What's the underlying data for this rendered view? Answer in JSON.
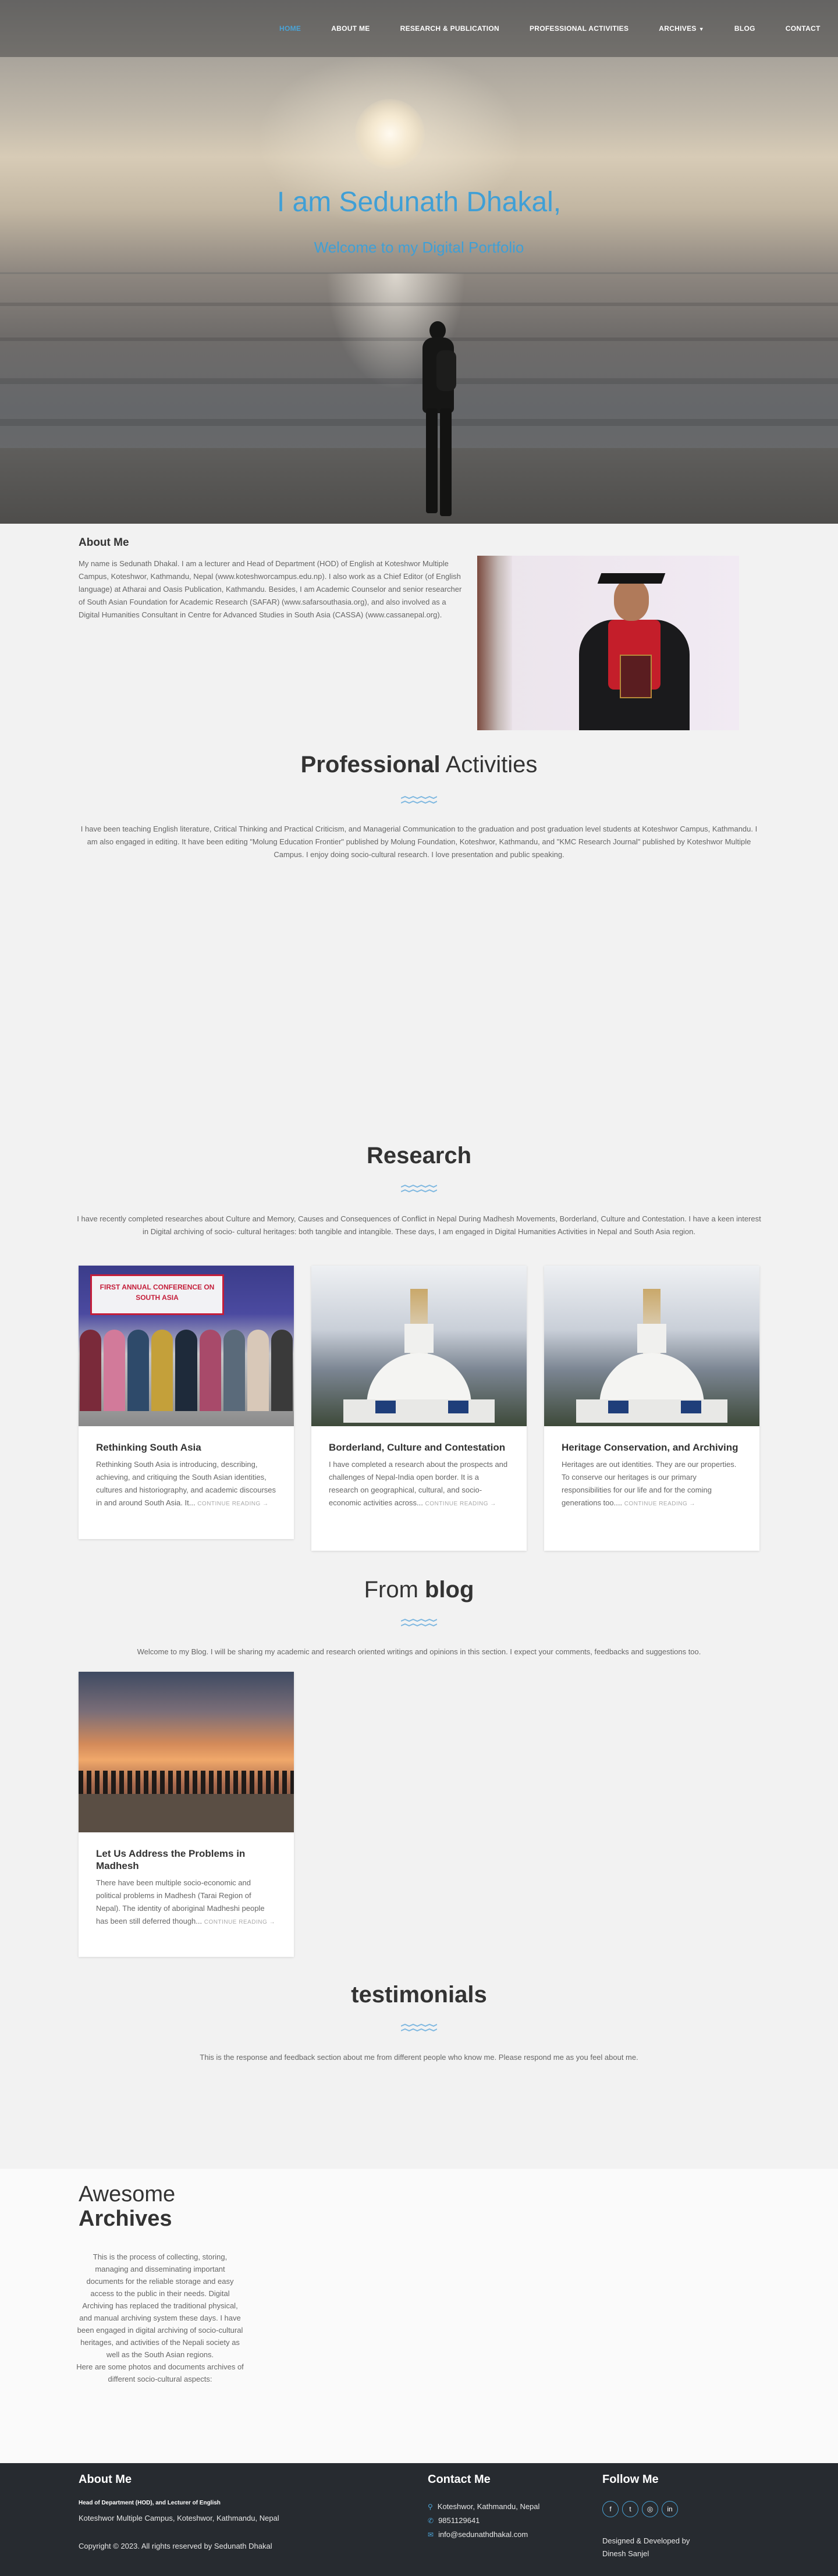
{
  "nav": {
    "items": [
      "HOME",
      "ABOUT ME",
      "RESEARCH & PUBLICATION",
      "PROFESSIONAL ACTIVITIES",
      "ARCHIVES",
      "BLOG",
      "CONTACT"
    ]
  },
  "hero": {
    "title": "I am Sedunath Dhakal,",
    "subtitle": "Welcome to my Digital Portfolio"
  },
  "about": {
    "heading": "About Me",
    "text": "My name is Sedunath Dhakal. I am a lecturer and Head of Department (HOD) of English at Koteshwor Multiple Campus, Koteshwor, Kathmandu, Nepal (www.koteshworcampus.edu.np). I also work as a Chief Editor (of English language) at Atharai and Oasis Publication, Kathmandu. Besides, I am Academic Counselor and senior researcher of South Asian Foundation for Academic Research (SAFAR) (www.safarsouthasia.org), and also involved as a Digital Humanities Consultant in Centre for Advanced Studies in South Asia (CASSA) (www.cassanepal.org)."
  },
  "professional": {
    "title_bold": "Professional",
    "title_rest": " Activities",
    "text": "I have been teaching English literature, Critical Thinking and Practical Criticism, and Managerial Communication to the graduation and post graduation level students at Koteshwor Campus, Kathmandu. I am also engaged in editing. It have been editing \"Molung Education Frontier\" published by Molung Foundation, Koteshwor, Kathmandu, and \"KMC Research Journal\" published by Koteshwor Multiple Campus. I enjoy doing socio-cultural research. I love presentation and public speaking."
  },
  "research": {
    "title": "Research",
    "text": "I have recently completed researches about Culture and Memory, Causes and Consequences of Conflict in Nepal During Madhesh Movements, Borderland, Culture and Contestation. I have a keen interest in Digital archiving of socio- cultural heritages: both tangible and intangible. These days, I am engaged in Digital Humanities Activities in Nepal and South Asia region.",
    "cards": [
      {
        "title": "Rethinking South Asia",
        "excerpt": "Rethinking South Asia is introducing, describing, achieving, and critiquing the South Asian identities, cultures and historiography, and academic discourses in and around South Asia. It...",
        "more": "CONTINUE READING →",
        "image_text": "FIRST ANNUAL CONFERENCE ON SOUTH ASIA"
      },
      {
        "title": "Borderland, Culture and Contestation",
        "excerpt": "I have completed a research about the prospects and challenges of Nepal-India open border. It is a research on geographical, cultural, and socio-economic activities across...",
        "more": "CONTINUE READING →"
      },
      {
        "title": "Heritage Conservation, and Archiving",
        "excerpt": "Heritages are out identities. They are our properties. To conserve our heritages is our primary responsibilities for our life and for the coming generations too....",
        "more": "CONTINUE READING →"
      }
    ]
  },
  "blog": {
    "title_rest": "From ",
    "title_bold": "blog",
    "text": "Welcome to my Blog. I will be sharing my academic and research oriented writings and opinions in this section. I expect your comments, feedbacks and suggestions too.",
    "cards": [
      {
        "title": "Let Us Address the Problems in Madhesh",
        "excerpt": "There have been multiple socio-economic and political problems in Madhesh (Tarai Region of Nepal). The identity of aboriginal Madheshi people has been still deferred though...",
        "more": "CONTINUE READING →"
      }
    ]
  },
  "testimonials": {
    "title": "testimonials",
    "text": "This is the response and feedback section about me from different people who know me. Please respond me as you feel about me."
  },
  "archives": {
    "title_light": "Awesome",
    "title_bold": "Archives",
    "text1": "This is the process of collecting, storing, managing and disseminating important documents for the reliable storage and easy access to the public in their needs. Digital Archiving has replaced the traditional physical, and manual archiving system these days. I have been engaged in digital archiving of socio-cultural heritages, and activities of the Nepali society as well as the South Asian regions.",
    "text2": "Here are some photos and documents archives of different socio-cultural aspects:"
  },
  "footer": {
    "about_heading": "About Me",
    "hod": "Head of Department (HOD), and Lecturer of English",
    "campus": "Koteshwor Multiple Campus, Koteshwor, Kathmandu, Nepal",
    "copyright": "Copyright © 2023. All rights reserved by Sedunath Dhakal",
    "contact_heading": "Contact Me",
    "address": "Koteshwor, Kathmandu, Nepal",
    "phone": "9851129641",
    "email": "info@sedunathdhakal.com",
    "follow_heading": "Follow Me",
    "social": [
      "f",
      "t",
      "◎",
      "in"
    ],
    "credit": "Designed & Developed by Dinesh Sanjel"
  },
  "colors": {
    "accent": "#3f9fd6",
    "footer_bg": "#272b30",
    "page_bg": "#f2f2f2"
  }
}
